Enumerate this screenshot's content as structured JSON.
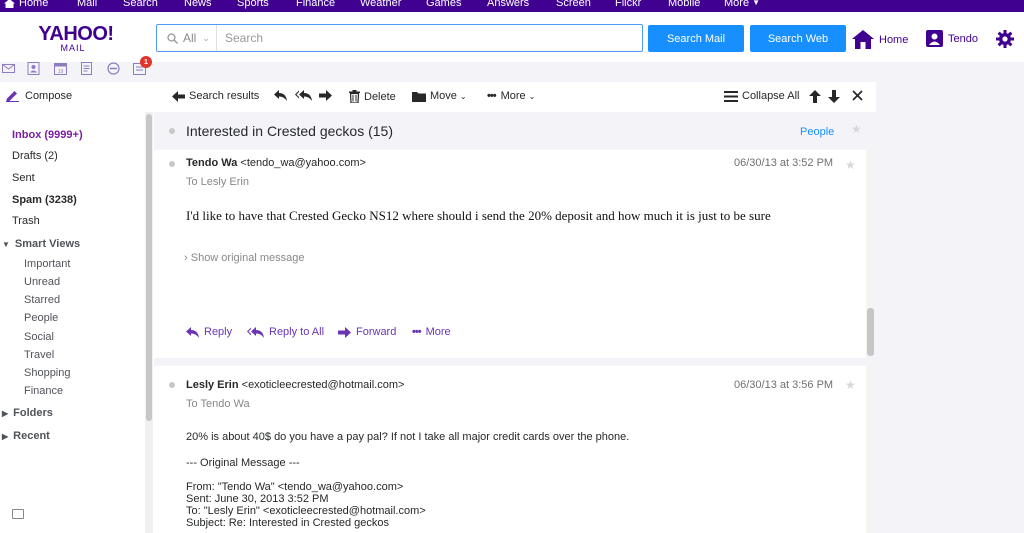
{
  "topnav": {
    "items": [
      "Home",
      "Mail",
      "Search",
      "News",
      "Sports",
      "Finance",
      "Weather",
      "Games",
      "Answers",
      "Screen",
      "Flickr",
      "Mobile",
      "More"
    ]
  },
  "header": {
    "logo_main": "YAHOO!",
    "logo_sub": "MAIL",
    "search_scope": "All",
    "search_placeholder": "Search",
    "search_mail_label": "Search Mail",
    "search_web_label": "Search Web",
    "home_label": "Home",
    "user_label": "Tendo"
  },
  "appicons": {
    "badge_count": "1"
  },
  "toolbar": {
    "search_results": "Search results",
    "delete": "Delete",
    "move": "Move",
    "more": "More",
    "collapse_all": "Collapse All"
  },
  "sidebar": {
    "compose": "Compose",
    "folders": [
      {
        "label": "Inbox (9999+)"
      },
      {
        "label": "Drafts (2)"
      },
      {
        "label": "Sent"
      },
      {
        "label": "Spam (3238)"
      },
      {
        "label": "Trash"
      }
    ],
    "smart_views_label": "Smart Views",
    "smart_views": [
      "Important",
      "Unread",
      "Starred",
      "People",
      "Social",
      "Travel",
      "Shopping",
      "Finance"
    ],
    "folders_label": "Folders",
    "recent_label": "Recent"
  },
  "conversation": {
    "subject": "Interested in Crested geckos (15)",
    "people_label": "People",
    "messages": [
      {
        "sender_name": "Tendo Wa",
        "sender_email": "<tendo_wa@yahoo.com>",
        "to": "To  Lesly Erin",
        "date": "06/30/13 at 3:52 PM",
        "body": "I'd like to have that Crested Gecko NS12 where should i send the 20% deposit and how much it is just to be sure",
        "show_original": "Show original message",
        "actions": {
          "reply": "Reply",
          "reply_all": "Reply to All",
          "forward": "Forward",
          "more": "More"
        }
      },
      {
        "sender_name": "Lesly Erin",
        "sender_email": "<exoticleecrested@hotmail.com>",
        "to": "To  Tendo Wa",
        "date": "06/30/13 at 3:56 PM",
        "body": "20% is about 40$ do you have a pay pal? If not I take all major credit cards over the phone.",
        "original_header": "--- Original Message ---",
        "orig_from": "From: \"Tendo Wa\" <tendo_wa@yahoo.com>",
        "orig_sent": "Sent: June 30, 2013 3:52 PM",
        "orig_to": "To: \"Lesly Erin\" <exoticleecrested@hotmail.com>",
        "orig_subject": "Subject: Re: Interested in Crested geckos"
      }
    ]
  },
  "colors": {
    "brand": "#400090",
    "accent_blue": "#188fff",
    "action_purple": "#6a35b5",
    "inbox_purple": "#7b1fa2"
  }
}
